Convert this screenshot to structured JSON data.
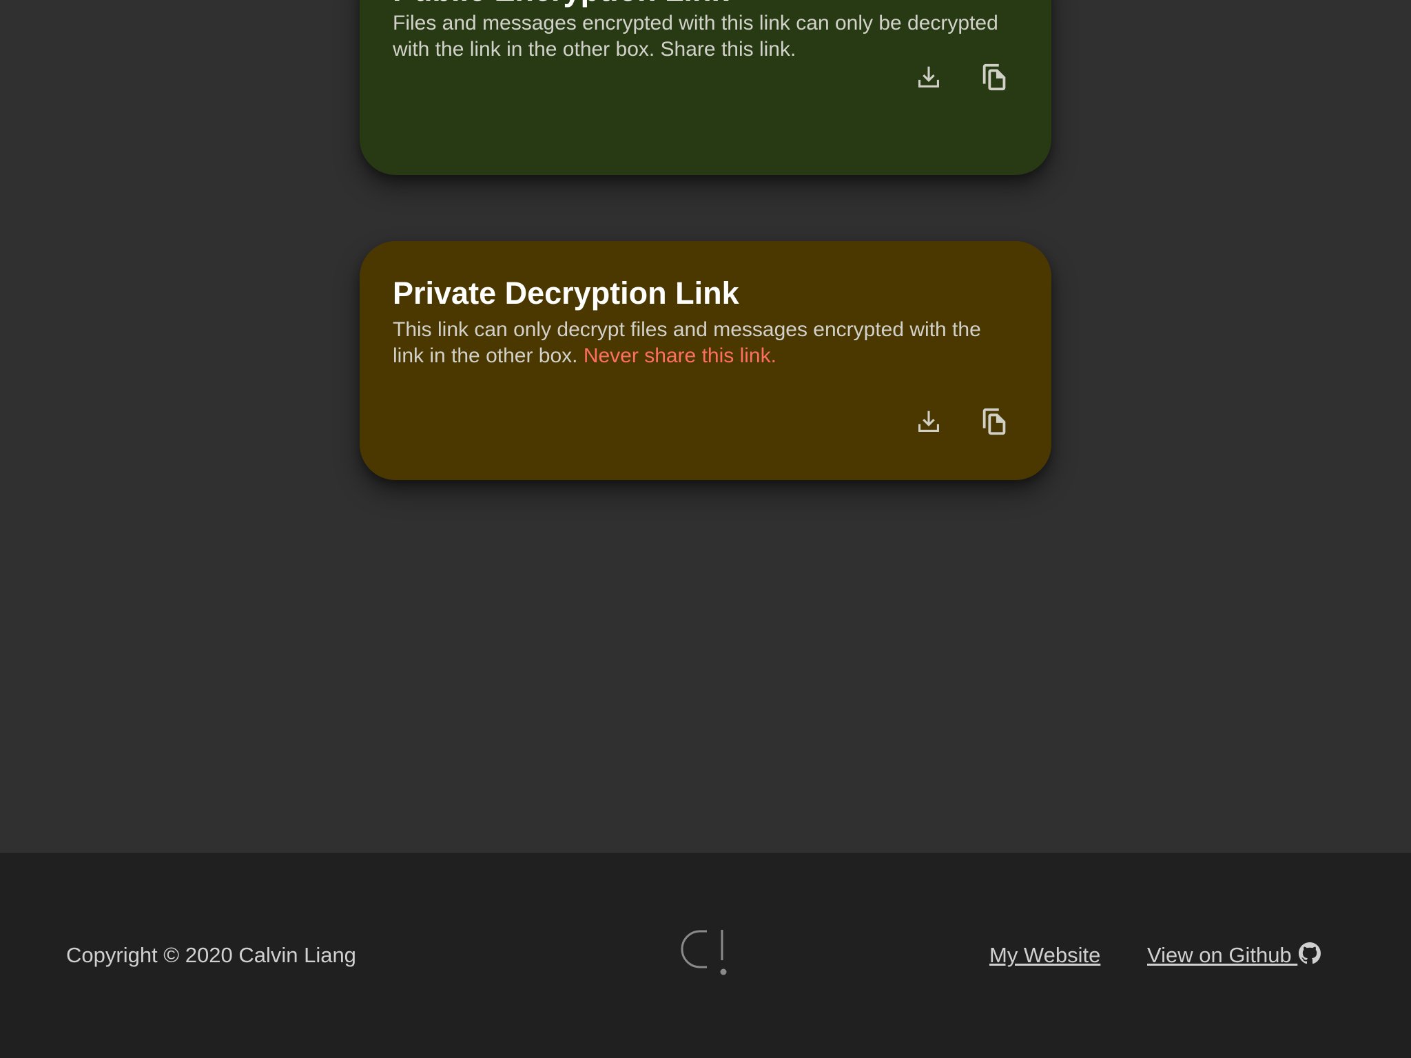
{
  "public_card": {
    "title": "Public Encryption Link",
    "description": "Files and messages encrypted with this link can only be decrypted with the link in the other box. Share this link.",
    "background": "#273a14",
    "actions": [
      {
        "icon": "download-icon"
      },
      {
        "icon": "copy-icon"
      }
    ]
  },
  "private_card": {
    "title": "Private Decryption Link",
    "description": "This link can only decrypt files and messages encrypted with the link in the other box. ",
    "warning": "Never share this link.",
    "background": "#4b3801",
    "warning_color": "#ff6f61",
    "actions": [
      {
        "icon": "download-icon"
      },
      {
        "icon": "copy-icon"
      }
    ]
  },
  "footer": {
    "copyright": "Copyright © 2020 Calvin Liang",
    "logo": "c-exclamation-logo",
    "links": {
      "website": "My Website",
      "github": "View on Github "
    },
    "background": "#202020"
  }
}
